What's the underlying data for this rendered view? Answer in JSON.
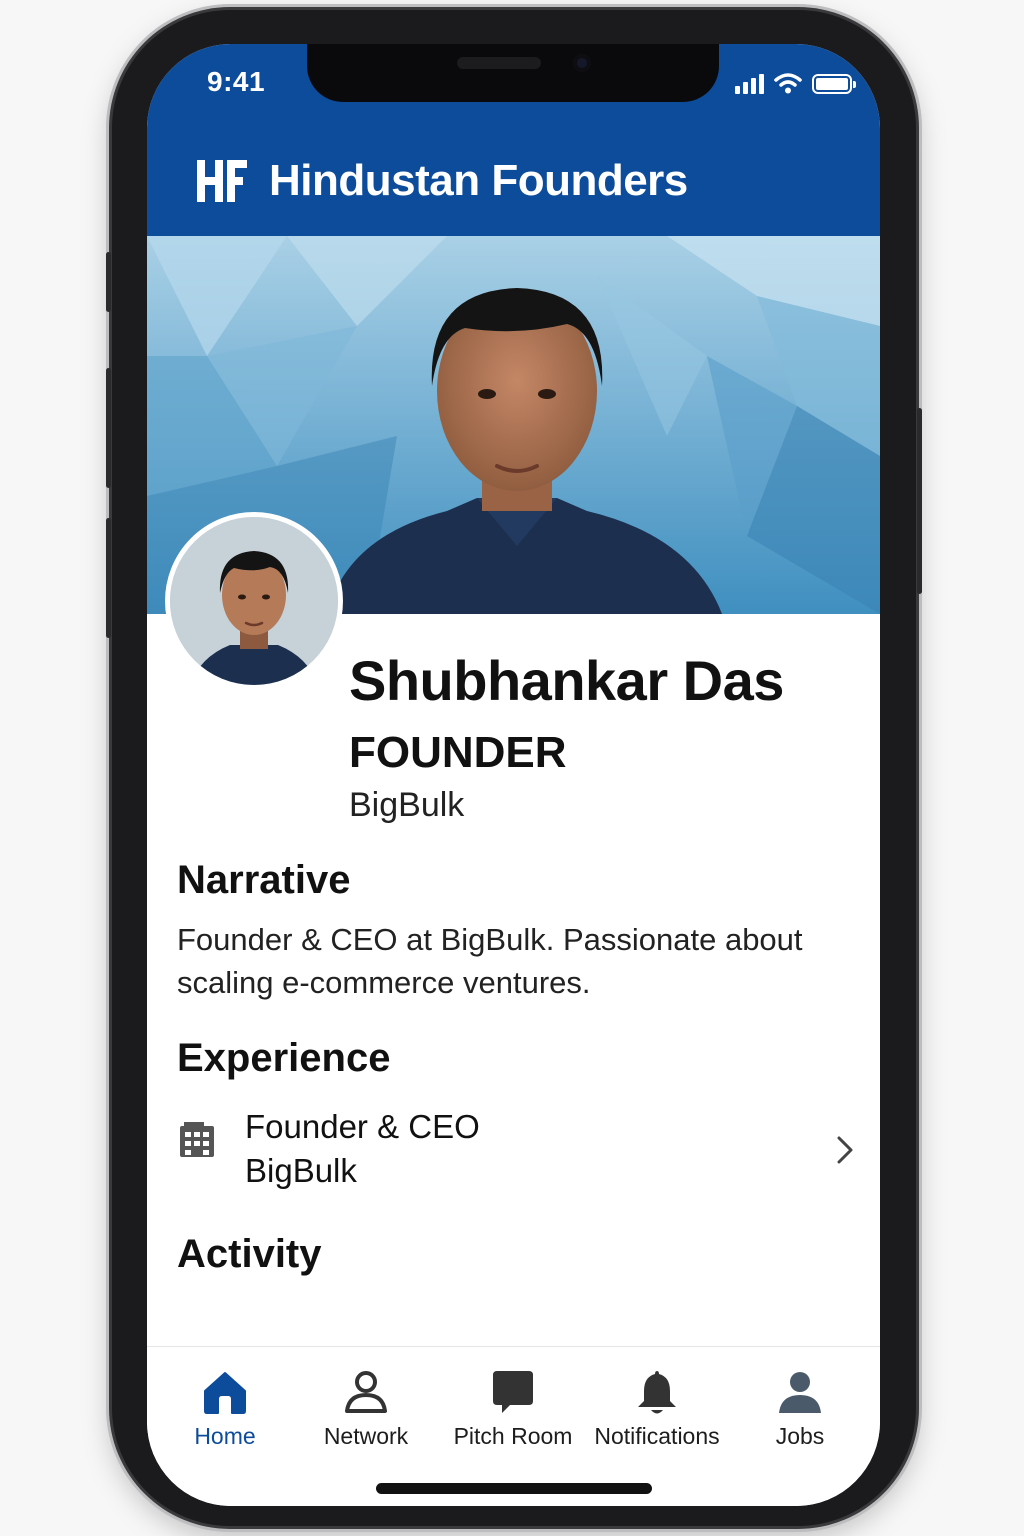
{
  "status_bar": {
    "time": "9:41"
  },
  "app": {
    "name": "Hindustan Founders",
    "logo_text": "HF",
    "brand_color": "#0d4c9a"
  },
  "profile": {
    "name": "Shubhankar Das",
    "role": "FOUNDER",
    "company": "BigBulk"
  },
  "narrative": {
    "title": "Narrative",
    "text": "Founder & CEO at BigBulk. Passionate about scaling e-commerce ventures."
  },
  "experience": {
    "title": "Experience",
    "items": [
      {
        "title": "Founder & CEO",
        "company": "BigBulk",
        "icon": "building-icon"
      }
    ]
  },
  "activity": {
    "title": "Activity"
  },
  "tabbar": {
    "tabs": [
      {
        "label": "Home",
        "icon": "home-icon",
        "active": true
      },
      {
        "label": "Network",
        "icon": "person-icon",
        "active": false
      },
      {
        "label": "Pitch Room",
        "icon": "chat-bubble-icon",
        "active": false
      },
      {
        "label": "Notifications",
        "icon": "bell-icon",
        "active": false
      },
      {
        "label": "Jobs",
        "icon": "user-icon",
        "active": false
      }
    ]
  }
}
